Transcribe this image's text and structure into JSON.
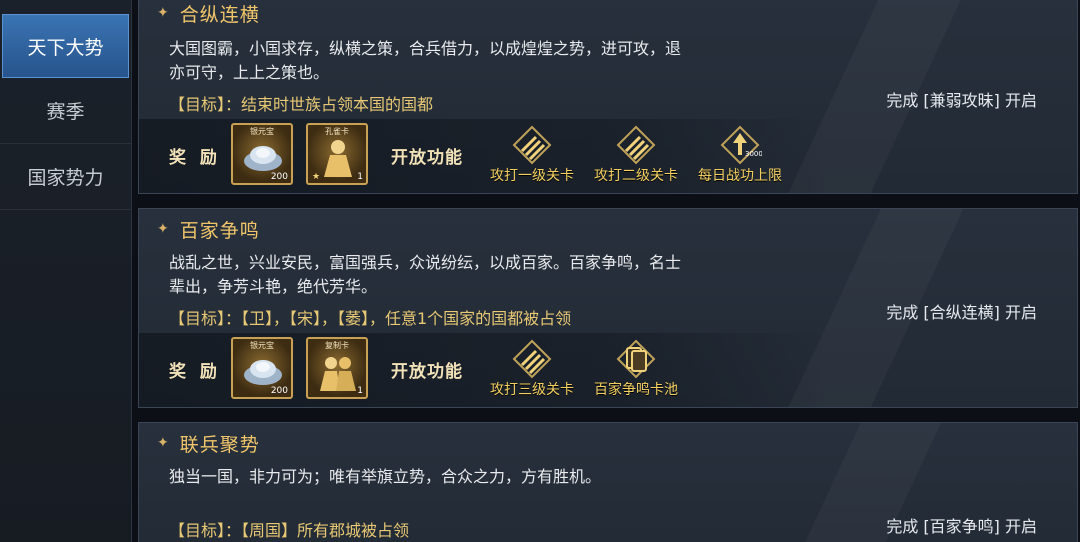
{
  "sidebar": {
    "items": [
      {
        "label": "天下大势",
        "active": true
      },
      {
        "label": "赛季",
        "active": false
      },
      {
        "label": "国家势力",
        "active": false
      }
    ]
  },
  "cards": [
    {
      "title": "合纵连横",
      "description": "大国图霸，小国求存，纵横之策，合兵借力，以成煌煌之势，进可攻，退亦可守，上上之策也。",
      "goal": "【目标】：结束时世族占领本国的国都",
      "unlock": "完成 [兼弱攻昧] 开启",
      "reward_label": "奖 励",
      "open_label": "开放功能",
      "rewards": [
        {
          "tag": "银元宝",
          "count": "200",
          "icon": "silver-ingot-icon"
        },
        {
          "tag": "孔雀卡",
          "count": "1",
          "stars": "★",
          "icon": "hero-card-icon"
        }
      ],
      "features": [
        {
          "label": "攻打一级关卡",
          "icon": "sword-badge-icon"
        },
        {
          "label": "攻打二级关卡",
          "icon": "sword-badge-icon"
        },
        {
          "label": "每日战功上限",
          "icon": "merit-limit-icon",
          "badge": "30000"
        }
      ]
    },
    {
      "title": "百家争鸣",
      "description": "战乱之世，兴业安民，富国强兵，众说纷纭，以成百家。百家争鸣，名士辈出，争芳斗艳，绝代芳华。",
      "goal": "【目标】：【卫】，【宋】，【萎】，任意1个国家的国都被占领",
      "unlock": "完成 [合纵连横] 开启",
      "reward_label": "奖 励",
      "open_label": "开放功能",
      "rewards": [
        {
          "tag": "银元宝",
          "count": "200",
          "icon": "silver-ingot-icon"
        },
        {
          "tag": "复制卡",
          "count": "1",
          "icon": "copy-card-icon"
        }
      ],
      "features": [
        {
          "label": "攻打三级关卡",
          "icon": "sword-badge-icon"
        },
        {
          "label": "百家争鸣卡池",
          "icon": "card-pool-icon"
        }
      ]
    },
    {
      "title": "联兵聚势",
      "description": "独当一国，非力可为；唯有举旗立势，合众之力，方有胜机。",
      "goal": "【目标】：【周国】所有郡城被占领",
      "unlock": "完成 [百家争鸣] 开启"
    }
  ],
  "colors": {
    "accent_gold": "#f0c56a",
    "active_tab": "#3a74b3",
    "feature_label": "#f3cf62"
  }
}
